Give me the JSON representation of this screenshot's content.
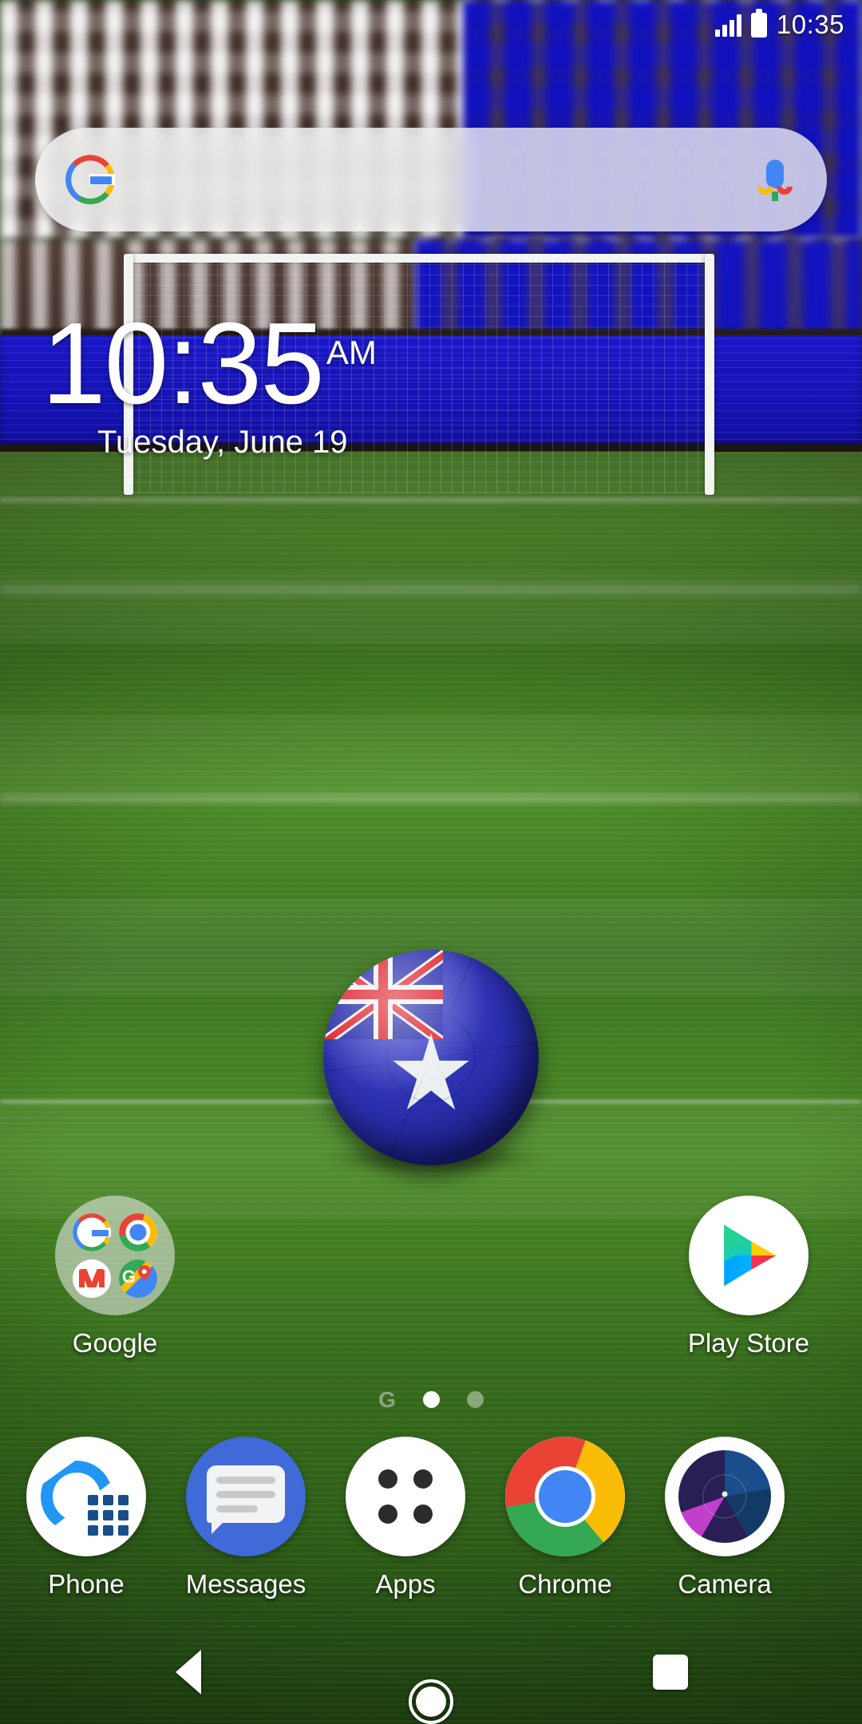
{
  "status_bar": {
    "time": "10:35",
    "signal_icon": "signal-bars-icon",
    "battery_icon": "battery-full-icon"
  },
  "search": {
    "value": "",
    "placeholder": "",
    "google_logo": "google-g-icon",
    "mic_icon": "microphone-icon"
  },
  "clock_widget": {
    "time": "10:35",
    "meridiem": "AM",
    "date": "Tuesday, June 19"
  },
  "home_icons": [
    {
      "label": "Google",
      "icon": "google-folder-icon",
      "folder_items": [
        "google-icon",
        "chrome-icon",
        "gmail-icon",
        "maps-icon"
      ]
    },
    {
      "label": "Play Store",
      "icon": "play-store-icon"
    }
  ],
  "page_indicator": {
    "google_feed_glyph": "G",
    "pages": 2,
    "active_page": 1
  },
  "dock": [
    {
      "label": "Phone",
      "icon": "phone-icon"
    },
    {
      "label": "Messages",
      "icon": "messages-icon"
    },
    {
      "label": "Apps",
      "icon": "apps-grid-icon"
    },
    {
      "label": "Chrome",
      "icon": "chrome-icon"
    },
    {
      "label": "Camera",
      "icon": "camera-icon"
    }
  ],
  "nav_bar": {
    "back": "back-icon",
    "home": "home-icon",
    "recents": "recents-icon"
  },
  "wallpaper": {
    "description": "soccer-stadium-australia-ball",
    "pitch_color": "#4a8a25",
    "hoarding_color": "#1512b4",
    "ball_flag": "australia"
  },
  "colors": {
    "google_blue": "#4285F4",
    "google_red": "#EA4335",
    "google_yellow": "#FBBC05",
    "google_green": "#34A853",
    "messages_blue": "#3F6AD8"
  }
}
